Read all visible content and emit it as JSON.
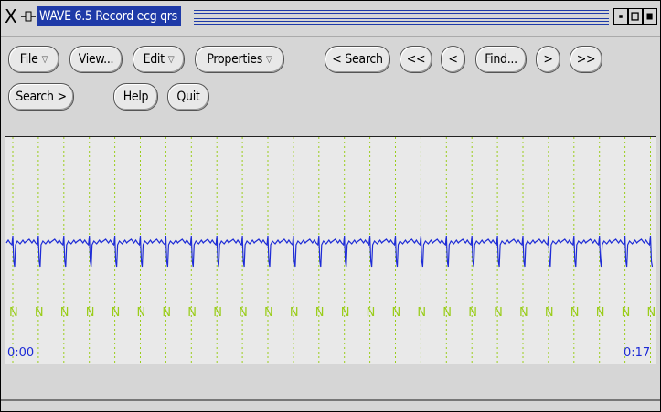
{
  "window": {
    "title": "WAVE 6.5  Record ecg qrs"
  },
  "toolbar": {
    "row1": [
      {
        "label": "File",
        "dropdown": true
      },
      {
        "label": "View...",
        "dropdown": false
      },
      {
        "label": "Edit",
        "dropdown": true
      },
      {
        "label": "Properties",
        "dropdown": true
      },
      {
        "label": "< Search",
        "dropdown": false
      },
      {
        "label": "<<",
        "dropdown": false
      },
      {
        "label": "<",
        "dropdown": false
      },
      {
        "label": "Find...",
        "dropdown": false
      },
      {
        "label": ">",
        "dropdown": false
      },
      {
        "label": ">>",
        "dropdown": false
      }
    ],
    "row2": [
      {
        "label": "Search >"
      },
      {
        "label": "Help"
      },
      {
        "label": "Quit"
      }
    ]
  },
  "signal": {
    "annotation_label": "N",
    "annotation_count": 26,
    "time_start": "0:00",
    "time_end": "0:17",
    "colors": {
      "trace": "#1d2bd6",
      "annotation": "#9acd1a",
      "grid": "#9acd1a",
      "time": "#1d2bd6"
    }
  }
}
